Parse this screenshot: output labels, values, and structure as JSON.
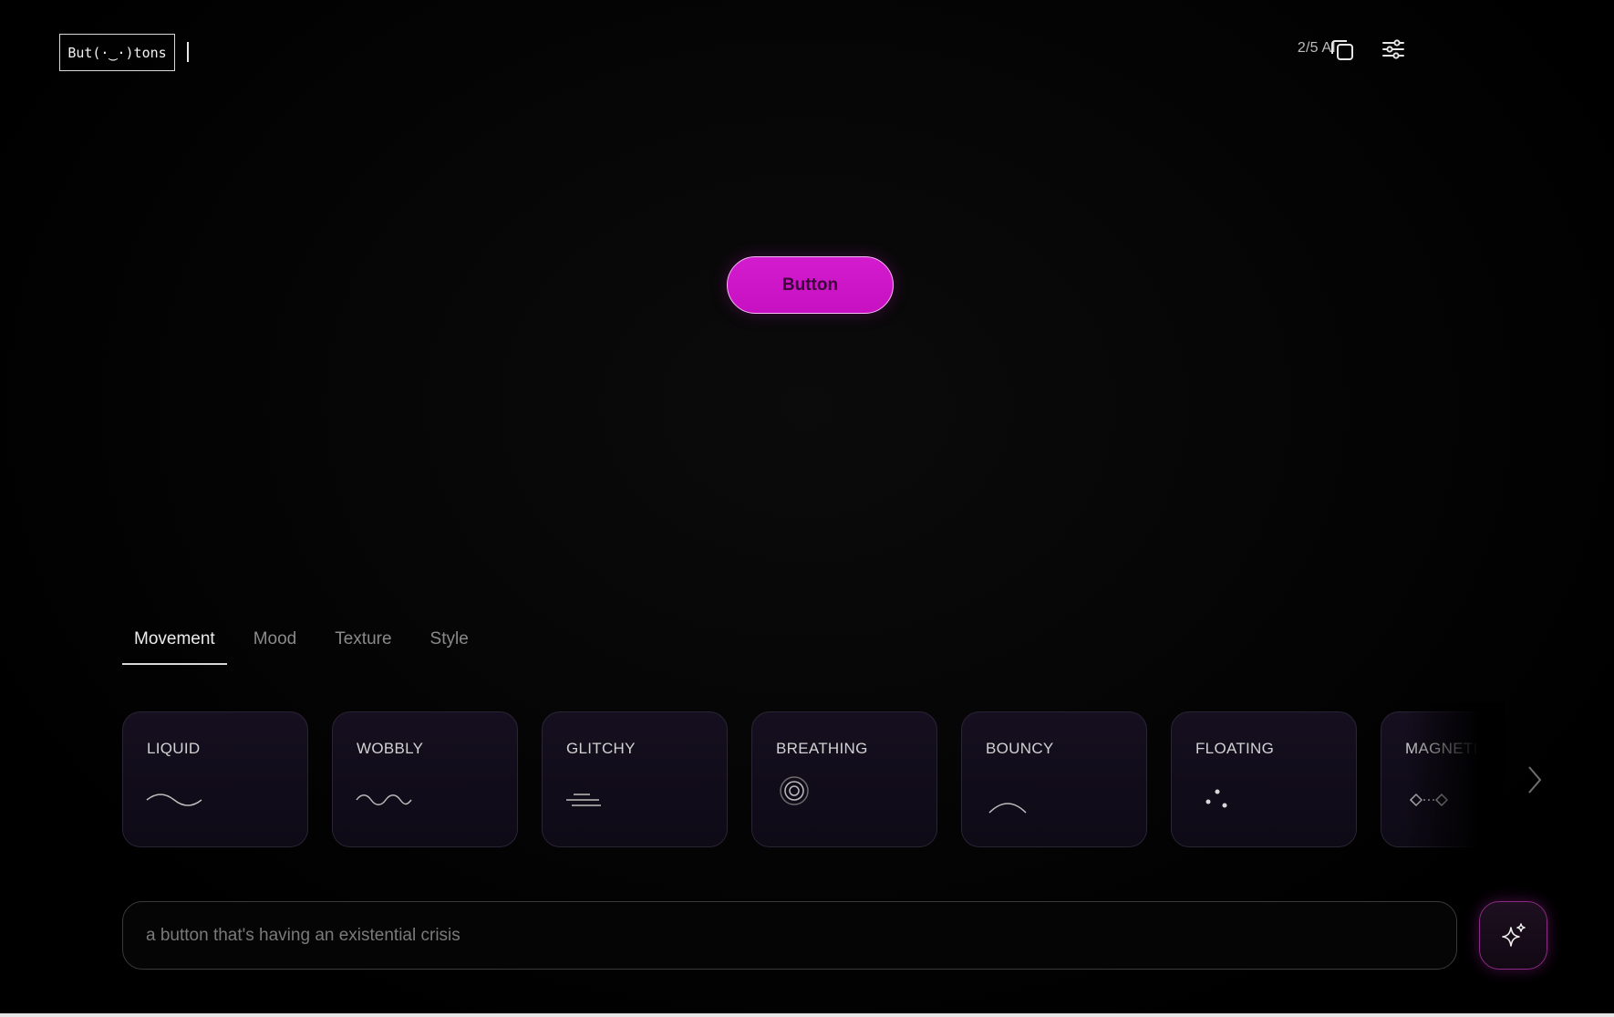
{
  "header": {
    "logo_text": "But(·‿·)tons",
    "ai_counter": "2/5 AI"
  },
  "preview": {
    "button_label": "Button",
    "accent_color": "#cc14c7"
  },
  "tabs": [
    {
      "label": "Movement",
      "active": true
    },
    {
      "label": "Mood",
      "active": false
    },
    {
      "label": "Texture",
      "active": false
    },
    {
      "label": "Style",
      "active": false
    }
  ],
  "cards": [
    {
      "label": "LIQUID",
      "icon": "wave-icon"
    },
    {
      "label": "WOBBLY",
      "icon": "wobble-icon"
    },
    {
      "label": "GLITCHY",
      "icon": "glitch-lines-icon"
    },
    {
      "label": "BREATHING",
      "icon": "concentric-circles-icon"
    },
    {
      "label": "BOUNCY",
      "icon": "arc-icon"
    },
    {
      "label": "FLOATING",
      "icon": "dots-icon"
    },
    {
      "label": "MAGNETIC",
      "icon": "linked-diamonds-icon"
    }
  ],
  "prompt": {
    "placeholder": "a button that's having an existential crisis",
    "value": ""
  },
  "icons": {
    "copy": "copy-icon",
    "settings": "sliders-icon",
    "next": "chevron-right-icon",
    "generate": "sparkle-icon"
  }
}
